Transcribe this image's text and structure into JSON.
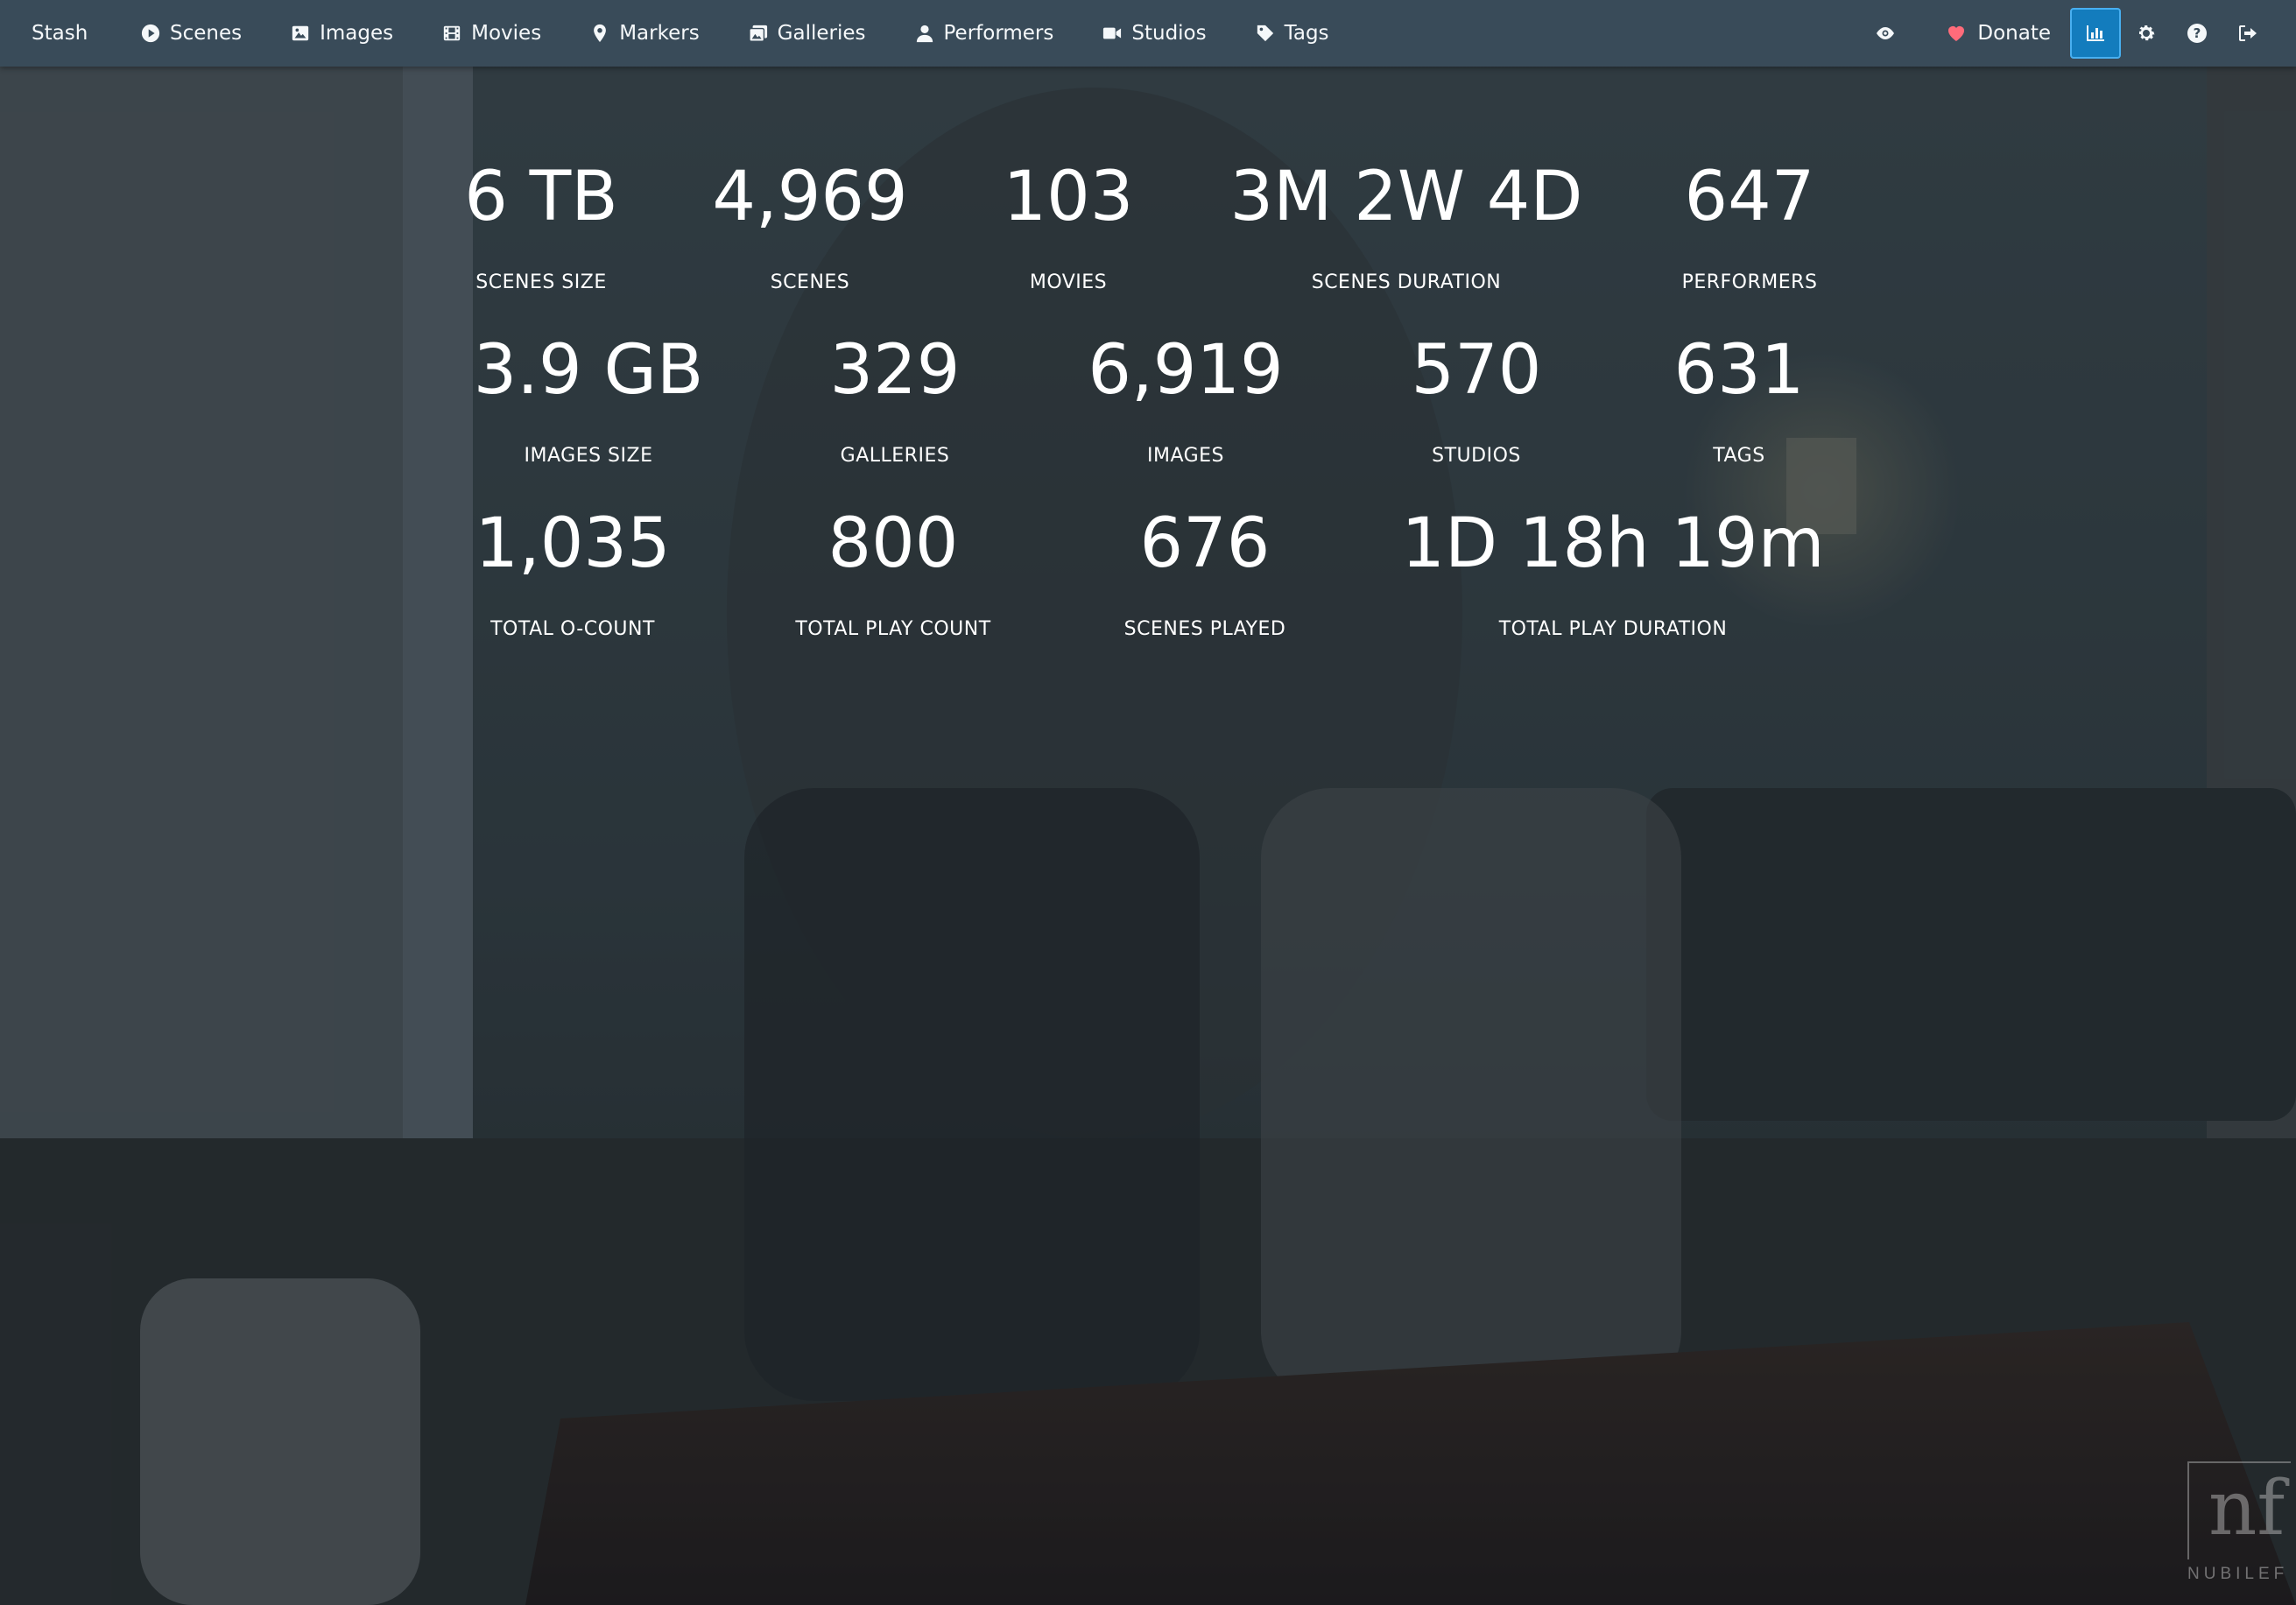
{
  "navbar": {
    "brand": "Stash",
    "items": [
      {
        "label": "Scenes",
        "icon": "play-circle-icon"
      },
      {
        "label": "Images",
        "icon": "image-icon"
      },
      {
        "label": "Movies",
        "icon": "film-icon"
      },
      {
        "label": "Markers",
        "icon": "map-marker-icon"
      },
      {
        "label": "Galleries",
        "icon": "images-icon"
      },
      {
        "label": "Performers",
        "icon": "user-icon"
      },
      {
        "label": "Studios",
        "icon": "video-icon"
      },
      {
        "label": "Tags",
        "icon": "tag-icon"
      }
    ],
    "right": {
      "donate_label": "Donate",
      "icons": [
        "eye-icon",
        "heart-icon",
        "stats-chart-icon",
        "gear-icon",
        "help-icon",
        "sign-out-icon"
      ],
      "active": "stats-chart-icon"
    },
    "colors": {
      "background": "#394b59",
      "active": "#137cbd",
      "heart": "#ff6b7a"
    }
  },
  "stats": [
    {
      "value": "6 TB",
      "label": "SCENES SIZE"
    },
    {
      "value": "4,969",
      "label": "SCENES"
    },
    {
      "value": "103",
      "label": "MOVIES"
    },
    {
      "value": "3M 2W 4D",
      "label": "SCENES DURATION"
    },
    {
      "value": "647",
      "label": "PERFORMERS"
    },
    {
      "value": "3.9 GB",
      "label": "IMAGES SIZE"
    },
    {
      "value": "329",
      "label": "GALLERIES"
    },
    {
      "value": "6,919",
      "label": "IMAGES"
    },
    {
      "value": "570",
      "label": "STUDIOS"
    },
    {
      "value": "631",
      "label": "TAGS"
    },
    {
      "value": "1,035",
      "label": "TOTAL O-COUNT"
    },
    {
      "value": "800",
      "label": "TOTAL PLAY COUNT"
    },
    {
      "value": "676",
      "label": "SCENES PLAYED"
    },
    {
      "value": "1D 18h 19m",
      "label": "TOTAL PLAY DURATION"
    }
  ],
  "watermark": {
    "text": "NUBILEF",
    "mark": "nf"
  }
}
